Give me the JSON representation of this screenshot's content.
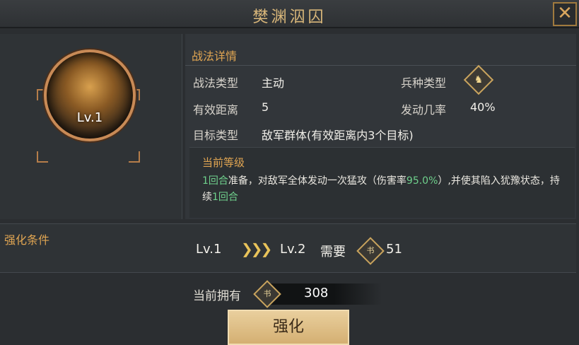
{
  "window": {
    "title": "樊渊泅囚",
    "close_label": "✕"
  },
  "skill": {
    "level_badge": "Lv.1"
  },
  "details": {
    "section_title": "战法详情",
    "type_label": "战法类型",
    "type_value": "主动",
    "troop_label": "兵种类型",
    "troop_icon": "horse-icon",
    "range_label": "有效距离",
    "range_value": "5",
    "chance_label": "发动几率",
    "chance_value": "40%",
    "target_label": "目标类型",
    "target_value": "敌军群体(有效距离内3个目标)"
  },
  "description": {
    "heading": "当前等级",
    "prep_turns": "1回合",
    "text_a": "准备，对敌军全体发动一次猛攻（伤害率",
    "damage_rate": "95.0%",
    "text_b": "）,并使其陷入犹豫状态，持续",
    "duration": "1回合"
  },
  "upgrade": {
    "label": "强化条件",
    "from_level": "Lv.1",
    "arrows": "❯❯❯",
    "to_level": "Lv.2",
    "need_label": "需要",
    "cost": "51",
    "book_icon": "book-icon"
  },
  "owned": {
    "label": "当前拥有",
    "count": "308"
  },
  "button": {
    "enhance_label": "强化"
  },
  "colors": {
    "accent_gold": "#e0a552",
    "highlight_green": "#6fd08c",
    "button_bg": "#d4af72"
  }
}
